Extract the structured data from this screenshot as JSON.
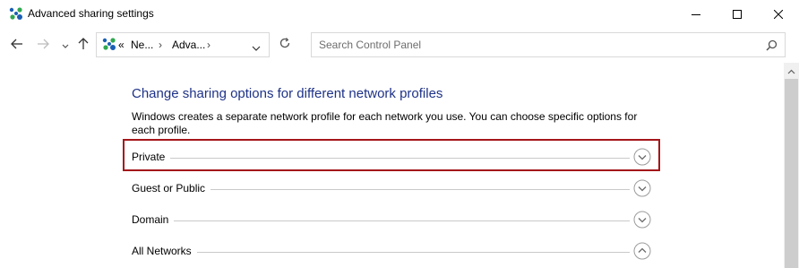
{
  "window": {
    "title": "Advanced sharing settings",
    "controls": [
      "minimize",
      "maximize",
      "close"
    ]
  },
  "navigation": {
    "back_icon": "arrow-left-icon",
    "forward_icon": "arrow-right-icon",
    "recent_icon": "chevron-down-icon",
    "up_icon": "arrow-up-icon",
    "address": {
      "overflow": "«",
      "crumbs": [
        "Ne...",
        "Adva..."
      ]
    },
    "refresh_icon": "refresh-icon",
    "search": {
      "placeholder": "Search Control Panel"
    }
  },
  "main": {
    "heading": "Change sharing options for different network profiles",
    "description": "Windows creates a separate network profile for each network you use. You can choose specific options for each profile.",
    "profiles": [
      {
        "label": "Private",
        "state": "collapsed",
        "highlighted": true
      },
      {
        "label": "Guest or Public",
        "state": "collapsed"
      },
      {
        "label": "Domain",
        "state": "collapsed"
      },
      {
        "label": "All Networks",
        "state": "expanded"
      }
    ]
  },
  "colors": {
    "heading": "#1e3287",
    "highlight_border": "#a4161a",
    "separator": "#c9c9c9"
  }
}
